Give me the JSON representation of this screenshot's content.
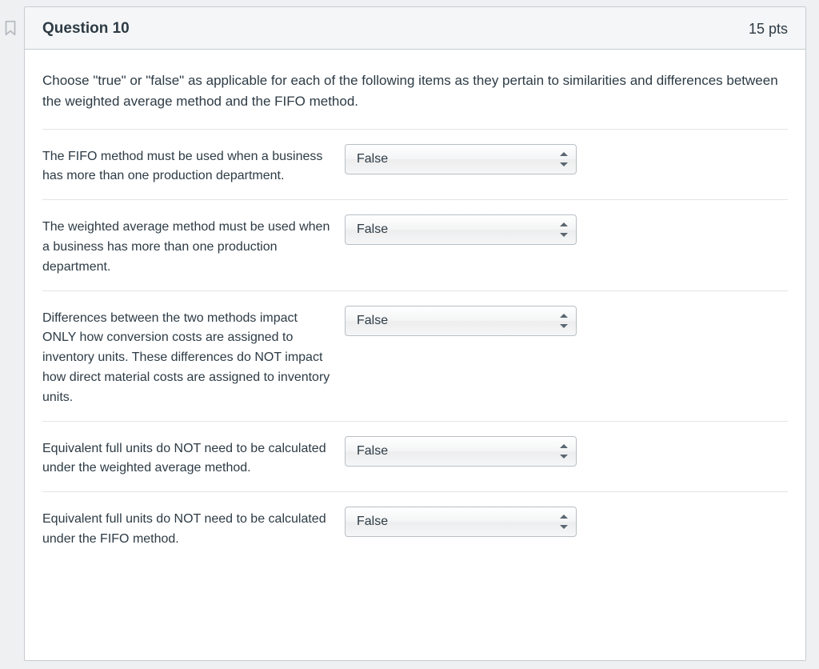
{
  "header": {
    "title": "Question 10",
    "points": "15 pts"
  },
  "prompt": "Choose \"true\" or \"false\" as applicable for each of the following items as they pertain to similarities and differences between the weighted average method and the FIFO method.",
  "items": [
    {
      "label": "The FIFO method must be used when a business has more than one production department.",
      "value": "False"
    },
    {
      "label": "The weighted average method must be used when a business has more than one production department.",
      "value": "False"
    },
    {
      "label": "Differences between the two methods impact ONLY how conversion costs are assigned to inventory units. These differences do NOT impact how direct material costs are assigned to inventory units.",
      "value": "False"
    },
    {
      "label": "Equivalent full units do NOT need to be calculated under the weighted average method.",
      "value": "False"
    },
    {
      "label": "Equivalent full units do NOT need to be calculated under the FIFO method.",
      "value": "False"
    }
  ]
}
